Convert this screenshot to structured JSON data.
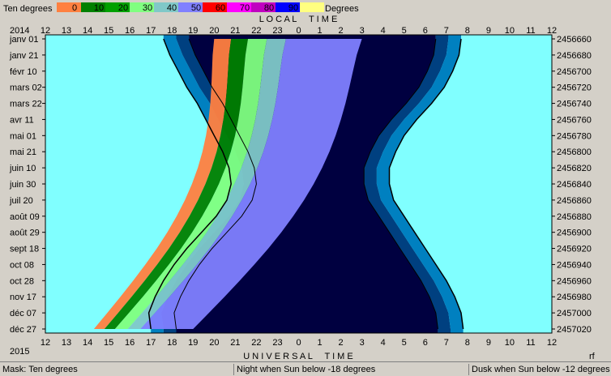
{
  "header": {
    "legend_left_label": "Ten degrees",
    "legend_right_label": "Degrees",
    "legend_values": [
      "0",
      "10",
      "20",
      "30",
      "40",
      "50",
      "60",
      "70",
      "80",
      "90"
    ],
    "legend_colors": [
      "#ff8040",
      "#008000",
      "#00a000",
      "#80ff80",
      "#80c8c8",
      "#8080ff",
      "#ff0000",
      "#ff00ff",
      "#c000c0",
      "#0000ff",
      "#ffff80"
    ],
    "year_top": "2014",
    "year_bottom": "2015",
    "local_time_label": "L O C A L     T I M E",
    "universal_time_label": "U N I V E R S A L     T I M E",
    "corner_label": "rf"
  },
  "status": {
    "mask": "Mask:  Ten degrees",
    "night": "Night when Sun below -18 degrees",
    "dusk": "Dusk when Sun below -12 degrees"
  },
  "chart_data": {
    "type": "heatmap",
    "hour_labels_top": [
      "12",
      "13",
      "14",
      "15",
      "16",
      "17",
      "18",
      "19",
      "20",
      "21",
      "22",
      "23",
      "0",
      "1",
      "2",
      "3",
      "4",
      "5",
      "6",
      "7",
      "8",
      "9",
      "10",
      "11",
      "12"
    ],
    "hour_labels_bottom": [
      "12",
      "13",
      "14",
      "15",
      "16",
      "17",
      "18",
      "19",
      "20",
      "21",
      "22",
      "23",
      "0",
      "1",
      "2",
      "3",
      "4",
      "5",
      "6",
      "7",
      "8",
      "9",
      "10",
      "11",
      "12"
    ],
    "date_labels": [
      "janv 01",
      "janv 21",
      "févr 10",
      "mars 02",
      "mars 22",
      "avr 11",
      "mai 01",
      "mai 21",
      "juin 10",
      "juin 30",
      "juil 20",
      "août 09",
      "août 29",
      "sept 18",
      "oct 08",
      "oct 28",
      "nov 17",
      "déc 07",
      "déc 27"
    ],
    "julian_day_labels": [
      "2456660",
      "2456680",
      "2456700",
      "2456720",
      "2456740",
      "2456760",
      "2456780",
      "2456800",
      "2456820",
      "2456840",
      "2456860",
      "2456880",
      "2456900",
      "2456920",
      "2456940",
      "2456960",
      "2456980",
      "2457000",
      "2457020"
    ],
    "sunset_hours": [
      17.6,
      17.9,
      18.3,
      18.7,
      19.2,
      19.6,
      20.0,
      20.4,
      20.7,
      20.8,
      20.6,
      20.1,
      19.4,
      18.7,
      18.1,
      17.6,
      17.2,
      16.9,
      17.0
    ],
    "sunrise_hours": [
      7.7,
      7.6,
      7.3,
      6.9,
      6.3,
      5.6,
      5.0,
      4.6,
      4.3,
      4.3,
      4.5,
      5.0,
      5.5,
      6.0,
      6.5,
      7.0,
      7.4,
      7.7,
      7.8
    ],
    "night_below_deg": -18,
    "dusk_below_deg": -12,
    "colors": {
      "day": "#80ffff",
      "twilight": "#0080c0",
      "dusk": "#004080",
      "night": "#000040",
      "alt_0_10": "#ff8040",
      "alt_10_20": "#008000",
      "alt_20_30": "#00a000",
      "alt_30_40": "#80ff80",
      "alt_40_50": "#80c8c8",
      "alt_50_60": "#8080ff"
    }
  }
}
